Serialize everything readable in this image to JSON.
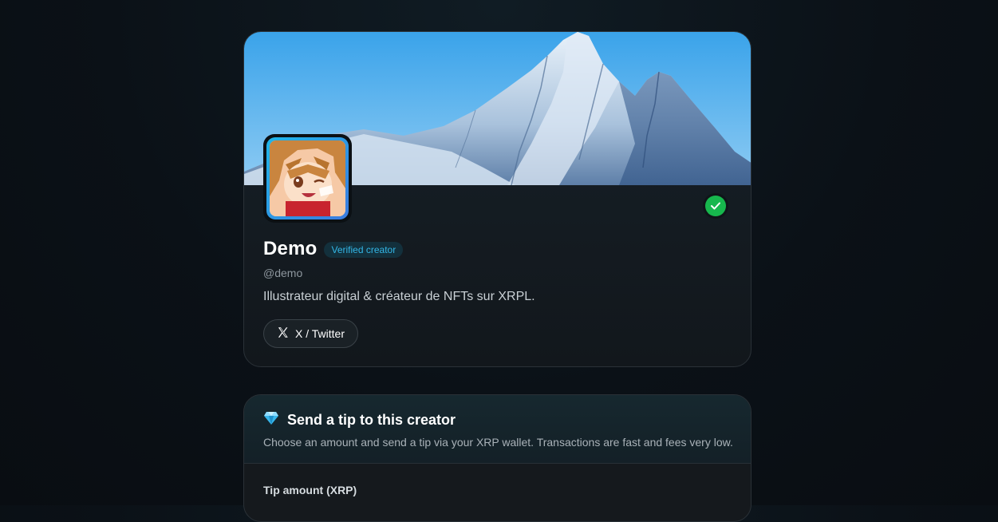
{
  "profile": {
    "name": "Demo",
    "badge": "Verified creator",
    "handle": "@demo",
    "bio": "Illustrateur digital & créateur de NFTs sur XRPL.",
    "social_label": "X / Twitter",
    "verified_color": "#17b74d",
    "badge_color": "#33b6e6"
  },
  "tip": {
    "icon": "gem-icon",
    "title": "Send a tip to this creator",
    "description": "Choose an amount and send a tip via your XRP wallet. Transactions are fast and fees very low.",
    "amount_label": "Tip amount (XRP)"
  }
}
